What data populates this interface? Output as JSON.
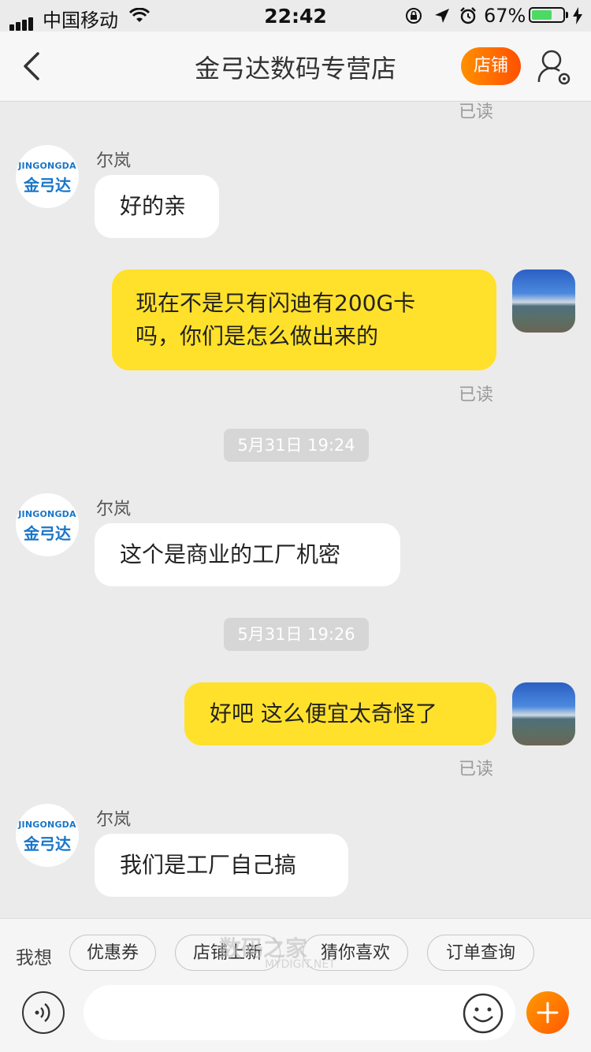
{
  "status_bar": {
    "carrier": "中国移动",
    "time": "22:42",
    "battery": "67%"
  },
  "nav": {
    "title": "金弓达数码专营店",
    "shop_button": "店铺"
  },
  "shop_avatar": {
    "en": "JINGONGDA",
    "cn": "金弓达"
  },
  "messages": [
    {
      "read_label": "已读"
    },
    {
      "sender": "尔岚",
      "text": "好的亲"
    },
    {
      "text_line1": "现在不是只有闪迪有200G卡",
      "text_line2": "吗，你们是怎么做出来的",
      "read_label": "已读"
    },
    {
      "timestamp": "5月31日 19:24"
    },
    {
      "sender": "尔岚",
      "text": "这个是商业的工厂机密"
    },
    {
      "timestamp": "5月31日 19:26"
    },
    {
      "text": "好吧 这么便宜太奇怪了",
      "read_label": "已读"
    },
    {
      "sender": "尔岚",
      "text": "我们是工厂自己搞"
    }
  ],
  "quick_bar": {
    "label": "我想",
    "chips": [
      "优惠券",
      "店铺上新",
      "猜你喜欢",
      "订单查询"
    ]
  },
  "watermark": {
    "main": "数码之家",
    "sub": "MYDIGIT.NET"
  },
  "colors": {
    "accent": "#ff5000",
    "my_bubble": "#ffe12b",
    "battery": "#4cd964"
  }
}
